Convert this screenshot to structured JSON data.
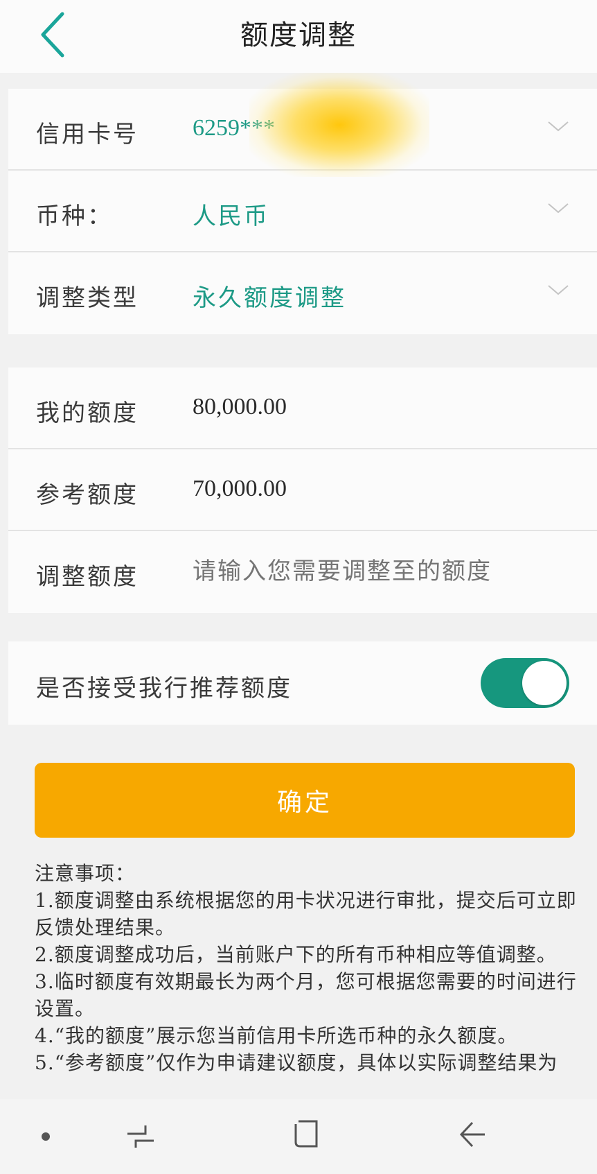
{
  "header": {
    "title": "额度调整",
    "back_icon": "chevron-left-icon"
  },
  "colors": {
    "accent": "#1d9a86",
    "button": "#f7a800",
    "toggle_on": "#16977e"
  },
  "selection": {
    "card_label": "信用卡号",
    "card_value": "6259***",
    "currency_label": "币种：",
    "currency_value": "人民币",
    "type_label": "调整类型",
    "type_value": "永久额度调整"
  },
  "amounts": {
    "my_limit_label": "我的额度",
    "my_limit_value": "80,000.00",
    "ref_limit_label": "参考额度",
    "ref_limit_value": "70,000.00",
    "adjust_label": "调整额度",
    "adjust_placeholder": "请输入您需要调整至的额度"
  },
  "recommend": {
    "label": "是否接受我行推荐额度",
    "enabled": true
  },
  "confirm_label": "确定",
  "notes": {
    "title": "注意事项：",
    "items": [
      "1.额度调整由系统根据您的用卡状况进行审批，提交后可立即反馈处理结果。",
      "2.额度调整成功后，当前账户下的所有币种相应等值调整。",
      "3.临时额度有效期最长为两个月，您可根据您需要的时间进行设置。",
      "4.“我的额度”展示您当前信用卡所选币种的永久额度。",
      "5.“参考额度”仅作为申请建议额度，具体以实际调整结果为"
    ]
  }
}
